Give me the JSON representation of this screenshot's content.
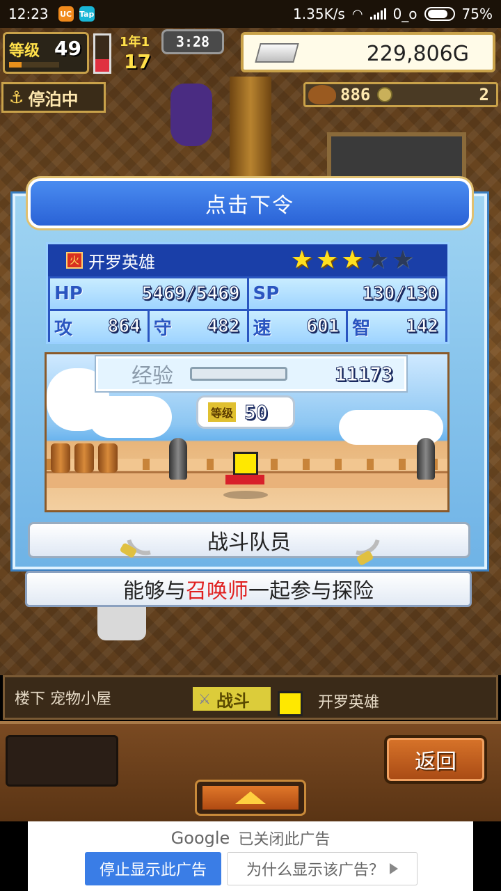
{
  "status": {
    "time": "12:23",
    "app1": "UC",
    "app2": "Tap",
    "speed": "1.35K/s",
    "carrier": "0_o",
    "battery": "75%"
  },
  "hud": {
    "level_label": "等级",
    "level_value": "49",
    "level_progress_fraction": 0.25,
    "gauge_fraction": 0.35,
    "year_label": "1年1",
    "year_value": "17",
    "clock": "3:28",
    "money": "229,806G",
    "dock_label": "停泊中",
    "resource1": "886",
    "resource2": "2"
  },
  "dialog": {
    "title": "点击下令",
    "hero_name": "开罗英雄",
    "stars_on": 3,
    "stars_total": 5,
    "stats": {
      "hp_label": "HP",
      "hp_value": "5469/5469",
      "sp_label": "SP",
      "sp_value": "130/130",
      "atk_label": "攻",
      "atk_value": "864",
      "def_label": "守",
      "def_value": "482",
      "spd_label": "速",
      "spd_value": "601",
      "int_label": "智",
      "int_value": "142"
    },
    "exp_label": "经验",
    "exp_value": "11173",
    "level_label": "等级",
    "level_value": "50",
    "crew_button": "战斗队员",
    "desc_pre": "能够与",
    "desc_highlight": "召唤师",
    "desc_post": "一起参与探险"
  },
  "locbar": {
    "location": "楼下 宠物小屋",
    "battle_tag": "战斗",
    "hero_name": "开罗英雄"
  },
  "panel": {
    "back_button": "返回"
  },
  "ad": {
    "google": "Google",
    "closed_text": "已关闭此广告",
    "stop_button": "停止显示此广告",
    "why_button": "为什么显示该广告？"
  },
  "colors": {
    "dialog_blue": "#2a62d6",
    "star_on": "#ffe020",
    "highlight_red": "#e02020",
    "ad_blue": "#3a7de6"
  }
}
